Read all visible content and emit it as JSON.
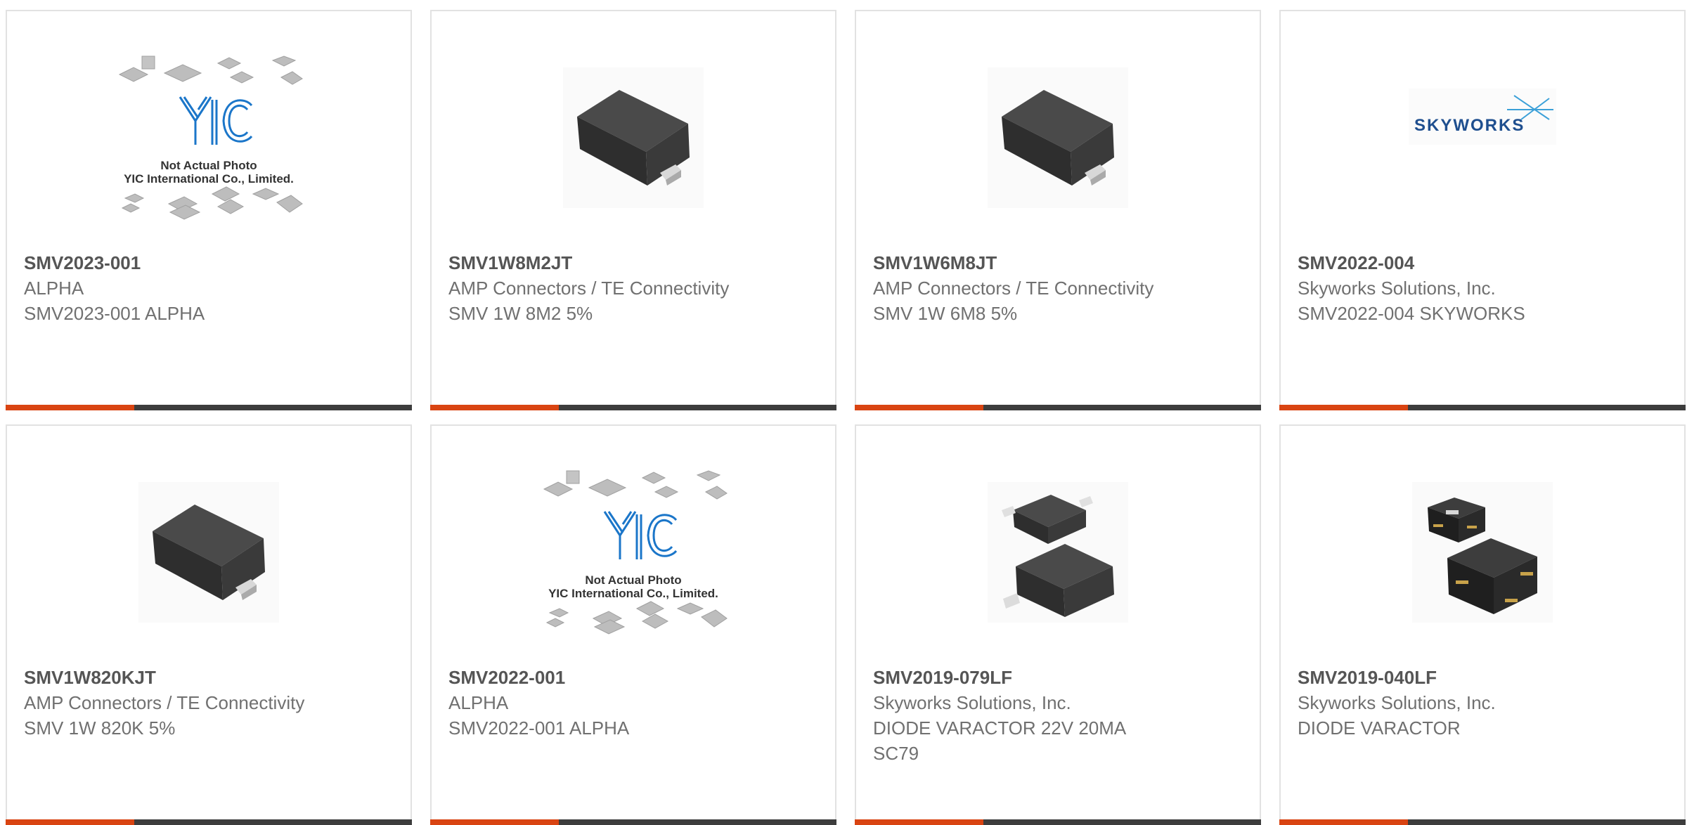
{
  "colors": {
    "accent": "#d94412",
    "bar": "#3d3d3d",
    "border": "#e2e2e2",
    "title": "#555555",
    "text": "#707070"
  },
  "cards": [
    {
      "part": "SMV2023-001",
      "manufacturer": "ALPHA",
      "description": "SMV2023-001 ALPHA",
      "image": "yic-not-actual-photo",
      "image_text": {
        "line1": "Not Actual Photo",
        "line2": "YIC International Co., Limited."
      }
    },
    {
      "part": "SMV1W8M2JT",
      "manufacturer": "AMP Connectors / TE Connectivity",
      "description": "SMV 1W 8M2 5%",
      "image": "smd-package-photo"
    },
    {
      "part": "SMV1W6M8JT",
      "manufacturer": "AMP Connectors / TE Connectivity",
      "description": "SMV 1W 6M8 5%",
      "image": "smd-package-photo"
    },
    {
      "part": "SMV2022-004",
      "manufacturer": "Skyworks Solutions, Inc.",
      "description": "SMV2022-004 SKYWORKS",
      "image": "skyworks-logo",
      "image_text": {
        "line1": "SKYWORKS"
      }
    },
    {
      "part": "SMV1W820KJT",
      "manufacturer": "AMP Connectors / TE Connectivity",
      "description": "SMV 1W 820K 5%",
      "image": "smd-package-photo"
    },
    {
      "part": "SMV2022-001",
      "manufacturer": "ALPHA",
      "description": "SMV2022-001 ALPHA",
      "image": "yic-not-actual-photo",
      "image_text": {
        "line1": "Not Actual Photo",
        "line2": "YIC International Co., Limited."
      }
    },
    {
      "part": "SMV2019-079LF",
      "manufacturer": "Skyworks Solutions, Inc.",
      "description": "DIODE VARACTOR 22V 20MA SC79",
      "image": "sc79-package-photo"
    },
    {
      "part": "SMV2019-040LF",
      "manufacturer": "Skyworks Solutions, Inc.",
      "description": "DIODE VARACTOR",
      "image": "sod882-package-photo"
    }
  ]
}
